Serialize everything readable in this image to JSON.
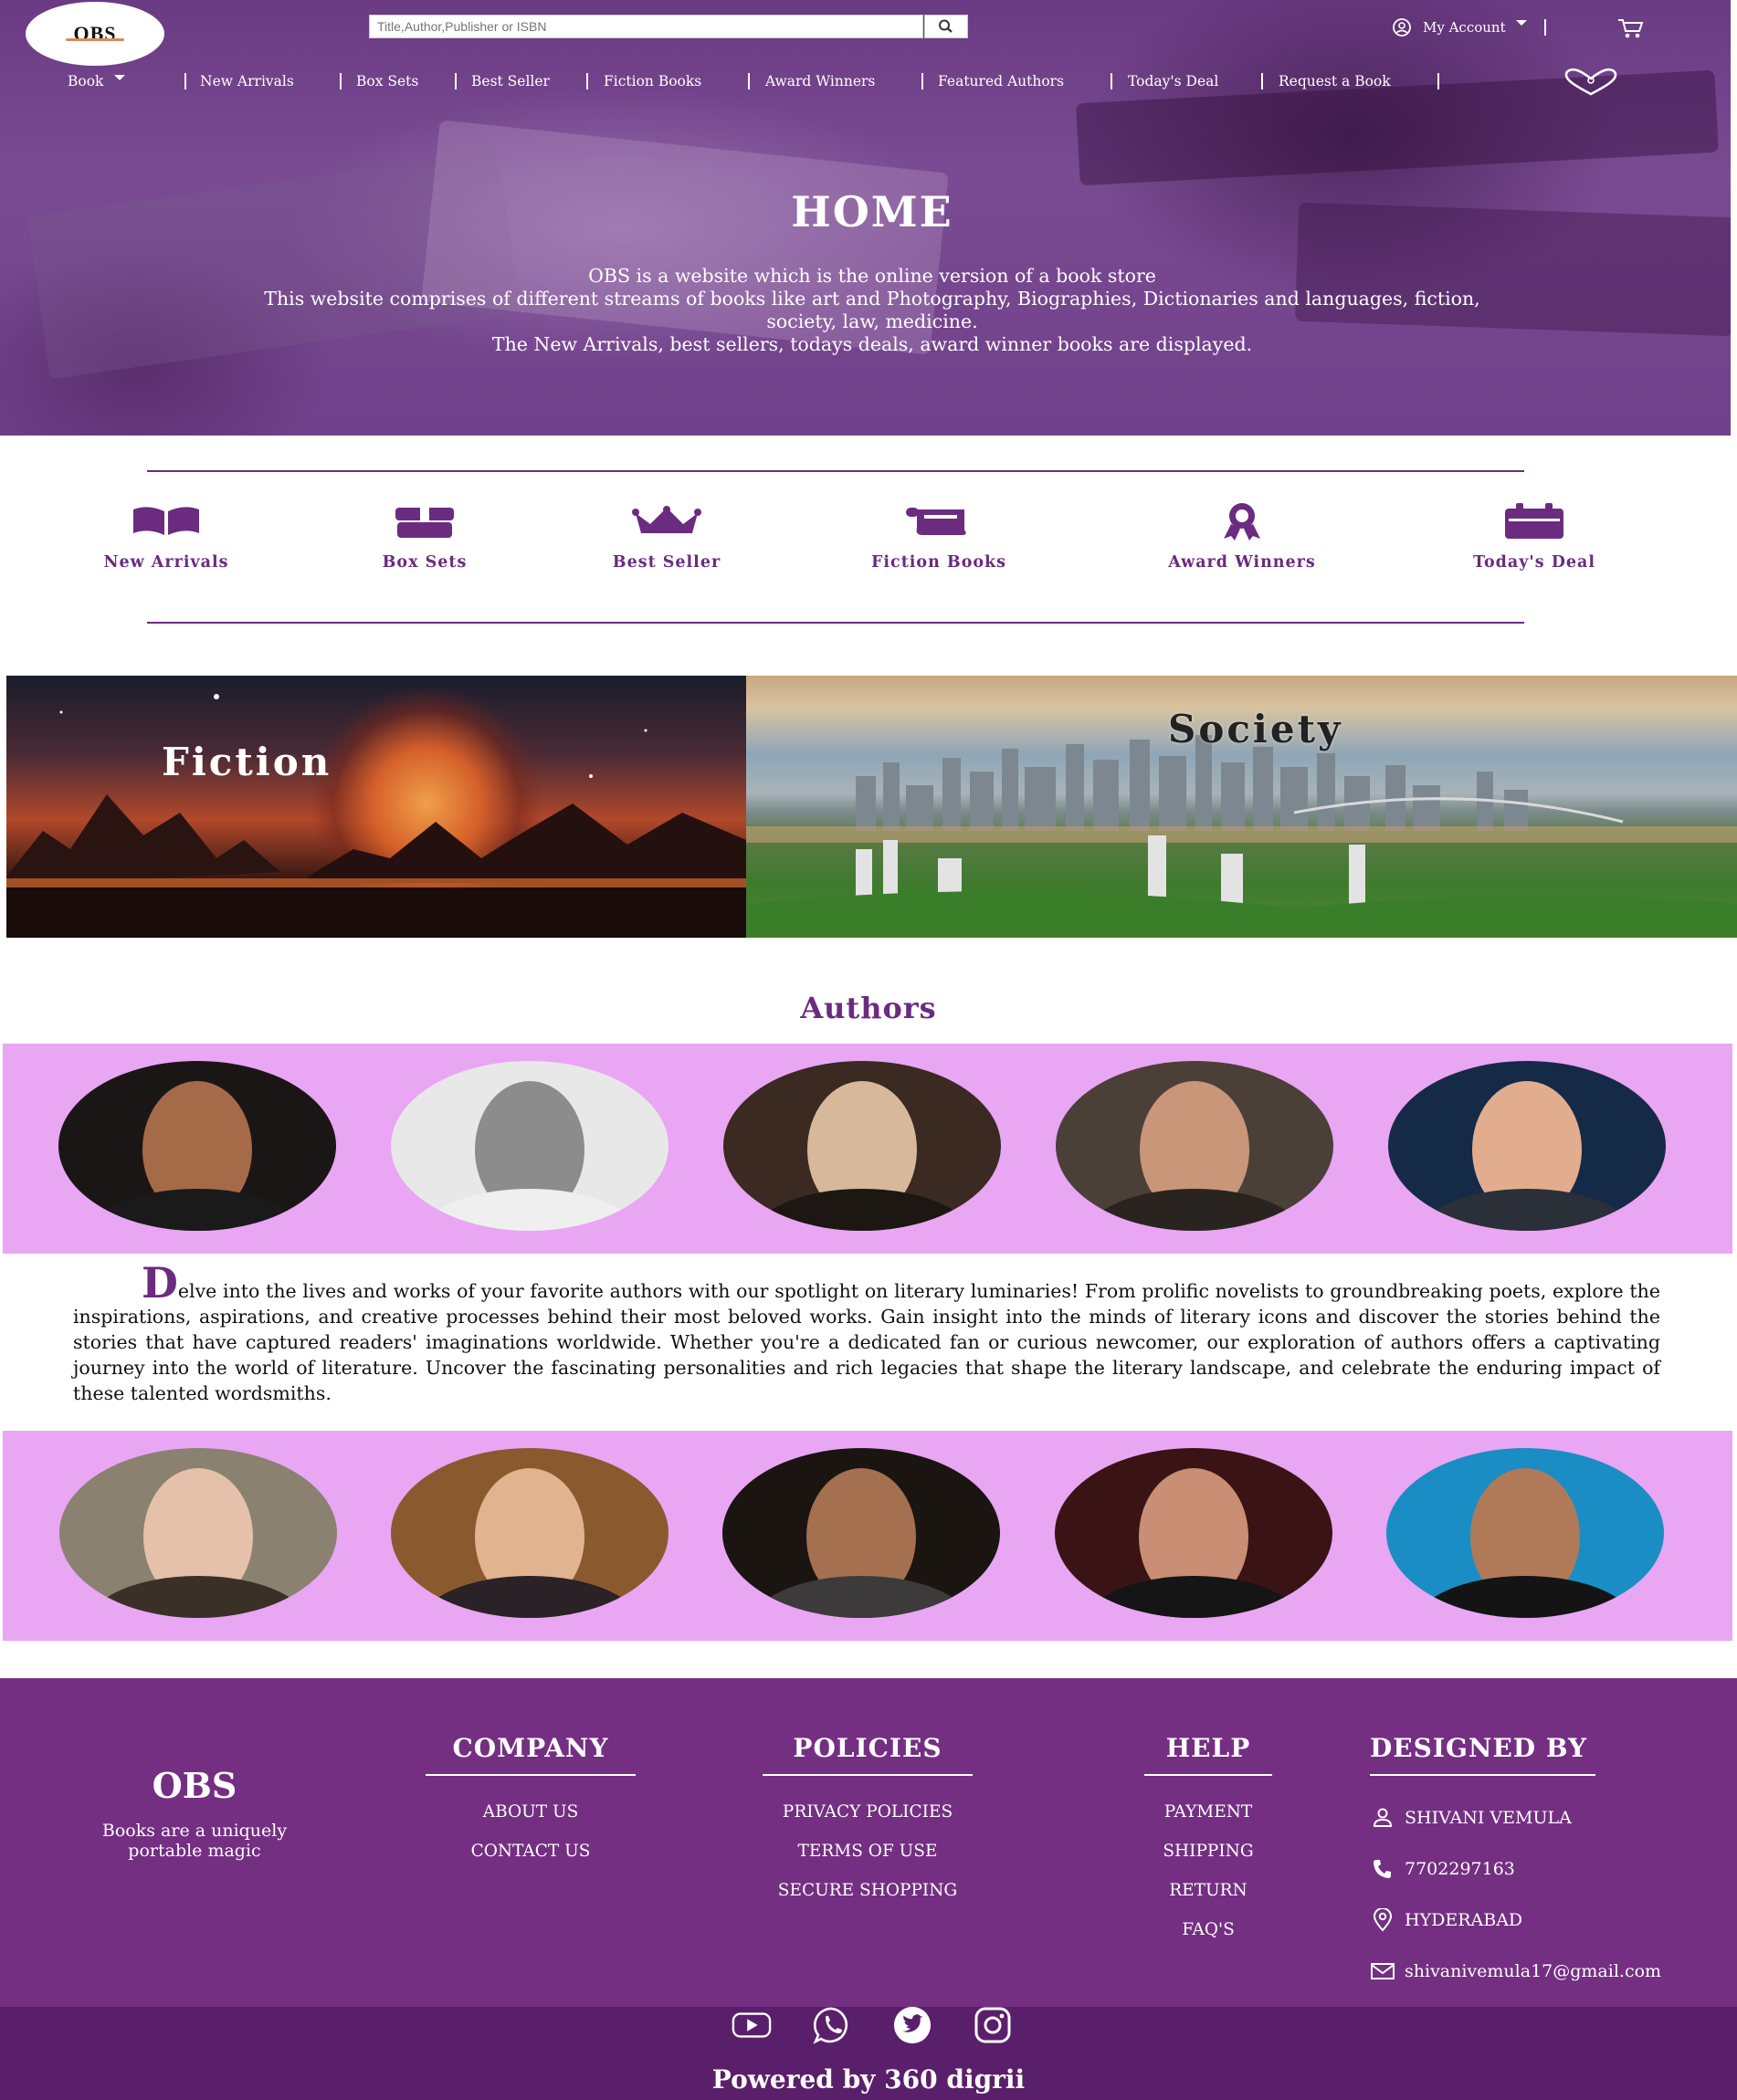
{
  "header": {
    "logo_text": "OBS",
    "search_placeholder": "Title,Author,Publisher or ISBN",
    "account_label": "My Account"
  },
  "nav": {
    "book_label": "Book",
    "items": [
      "New Arrivals",
      "Box Sets",
      "Best Seller",
      "Fiction Books",
      "Award Winners",
      "Featured Authors",
      "Today's Deal",
      "Request a Book"
    ]
  },
  "hero": {
    "title": "HOME",
    "lines": [
      "OBS is a website which is the online version of a book store",
      "This website comprises of different streams of books like art and Photography, Biographies, Dictionaries and languages, fiction, society, law, medicine.",
      "The New Arrivals, best sellers, todays deals, award winner books are displayed."
    ]
  },
  "categories": [
    {
      "label": "New Arrivals",
      "icon": "open-book-icon"
    },
    {
      "label": "Box Sets",
      "icon": "box-icon"
    },
    {
      "label": "Best Seller",
      "icon": "crown-icon"
    },
    {
      "label": "Fiction Books",
      "icon": "scroll-icon"
    },
    {
      "label": "Award Winners",
      "icon": "award-icon"
    },
    {
      "label": "Today's Deal",
      "icon": "calendar-icon"
    }
  ],
  "genres": {
    "fiction": "Fiction",
    "society": "Society"
  },
  "authors": {
    "title": "Authors",
    "dropcap": "D",
    "paragraph": "elve into the lives and works of your favorite authors with our spotlight on literary luminaries! From prolific novelists to groundbreaking poets, explore the inspirations, aspirations, and creative processes behind their most beloved works. Gain insight into the minds of literary icons and discover the stories behind the stories that have captured readers' imaginations worldwide. Whether you're a dedicated fan or curious newcomer, our exploration of authors offers a captivating journey into the world of literature. Uncover the fascinating personalities and rich legacies that shape the literary landscape, and celebrate the enduring impact of these talented wordsmiths."
  },
  "footer": {
    "brand": "OBS",
    "tagline": "Books are a uniquely portable magic",
    "company": {
      "heading": "COMPANY",
      "links": [
        "ABOUT US",
        "CONTACT US"
      ]
    },
    "policies": {
      "heading": "POLICIES",
      "links": [
        "PRIVACY POLICIES",
        "TERMS OF USE",
        "SECURE SHOPPING"
      ]
    },
    "help": {
      "heading": "HELP",
      "links": [
        "PAYMENT",
        "SHIPPING",
        "RETURN",
        "FAQ'S"
      ]
    },
    "designed_by": {
      "heading": "DESIGNED BY",
      "name": "SHIVANI VEMULA",
      "phone": "7702297163",
      "location": "HYDERABAD",
      "email": "shivanivemula17@gmail.com"
    },
    "social_icons": [
      "youtube-icon",
      "whatsapp-icon",
      "twitter-icon",
      "instagram-icon"
    ],
    "powered_by": "Powered by 360 digrii"
  },
  "colors": {
    "brand_purple": "#742f82",
    "accent_purple": "#6b2b7f",
    "author_band": "#e9a6f3"
  }
}
